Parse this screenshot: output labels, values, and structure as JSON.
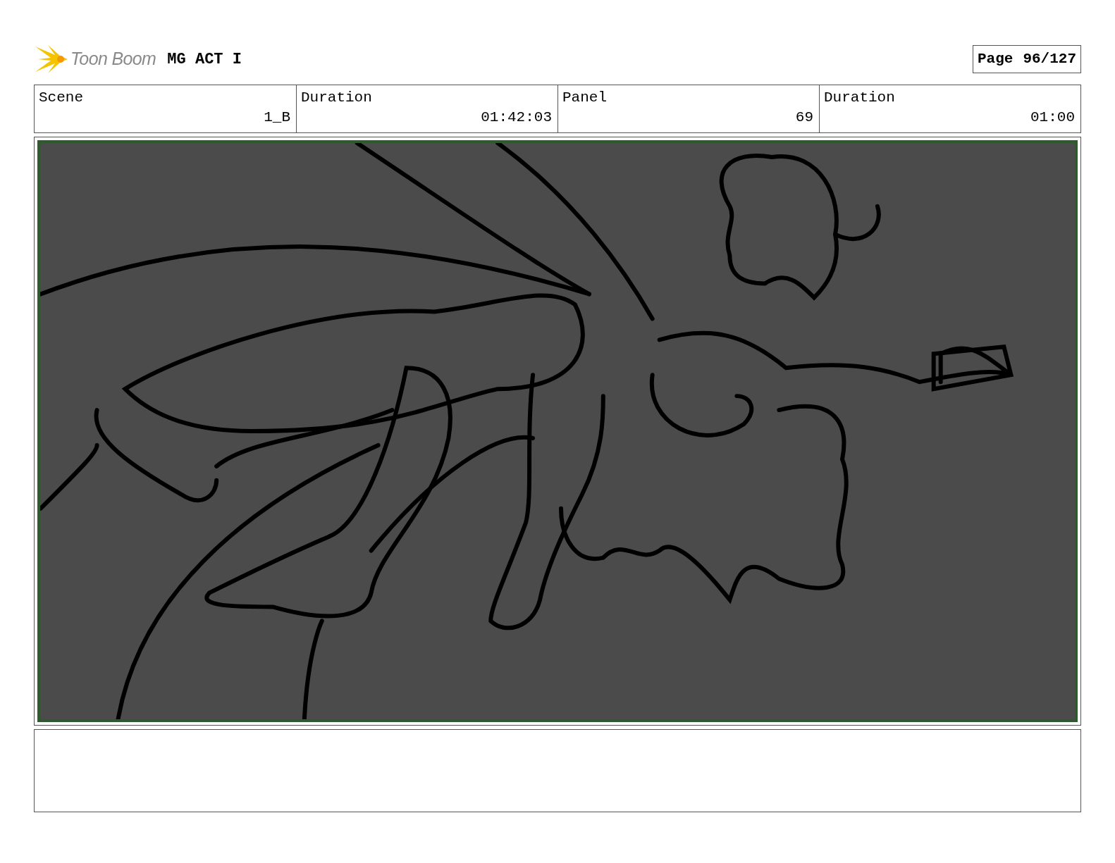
{
  "header": {
    "logo_text": "Toon Boom",
    "title": "MG ACT I",
    "page_label": "Page",
    "page_number": "96/127"
  },
  "info_table": {
    "columns": [
      "Scene",
      "Duration",
      "Panel",
      "Duration"
    ],
    "row": [
      "1_B",
      "01:42:03",
      "69",
      "01:00"
    ]
  }
}
